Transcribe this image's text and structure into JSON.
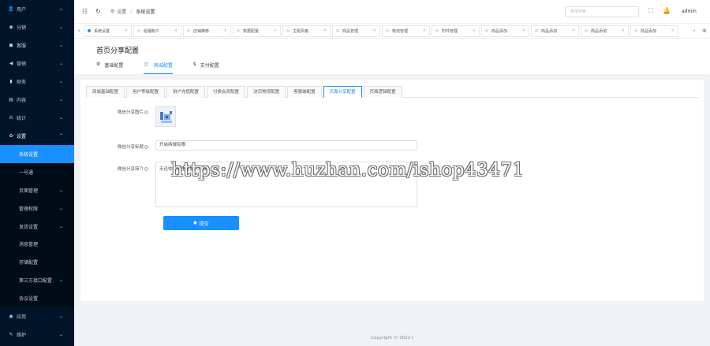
{
  "sidebar": {
    "items": [
      {
        "icon": "user-icon",
        "glyph": "👤",
        "label": "用户"
      },
      {
        "icon": "distribution-icon",
        "glyph": "◉",
        "label": "分销"
      },
      {
        "icon": "customer-service-icon",
        "glyph": "◼",
        "label": "客服"
      },
      {
        "icon": "marketing-icon",
        "glyph": "◀",
        "label": "营销"
      },
      {
        "icon": "finance-icon",
        "glyph": "▮",
        "label": "财务"
      },
      {
        "icon": "content-icon",
        "glyph": "▤",
        "label": "内容"
      },
      {
        "icon": "stats-icon",
        "glyph": "ılı",
        "label": "统计"
      },
      {
        "icon": "settings-icon",
        "glyph": "✿",
        "label": "设置"
      }
    ],
    "sub_items": [
      {
        "label": "系统设置",
        "active": true,
        "chev": false
      },
      {
        "label": "一号通",
        "active": false,
        "chev": false
      },
      {
        "label": "页面管理",
        "active": false,
        "chev": true
      },
      {
        "label": "管理权限",
        "active": false,
        "chev": true
      },
      {
        "label": "发货设置",
        "active": false,
        "chev": true
      },
      {
        "label": "消息管理",
        "active": false,
        "chev": false
      },
      {
        "label": "存储配置",
        "active": false,
        "chev": false
      },
      {
        "label": "第三方接口配置",
        "active": false,
        "chev": true
      },
      {
        "label": "协议设置",
        "active": false,
        "chev": false
      }
    ],
    "bottom_items": [
      {
        "icon": "app-icon",
        "glyph": "◉",
        "label": "应用"
      },
      {
        "icon": "maintenance-icon",
        "glyph": "✎",
        "label": "维护"
      }
    ]
  },
  "header": {
    "breadcrumb_root": "设置",
    "breadcrumb_current": "系统设置",
    "search_placeholder": "菜单搜索",
    "user": "admin"
  },
  "tabs": [
    {
      "label": "系统设置",
      "active": true
    },
    {
      "label": "组播账户",
      "active": false
    },
    {
      "label": "店铺推荐",
      "active": false
    },
    {
      "label": "数据配置",
      "active": false
    },
    {
      "label": "主题风格",
      "active": false
    },
    {
      "label": "商品管理",
      "active": false
    },
    {
      "label": "物流管理",
      "active": false
    },
    {
      "label": "附件管理",
      "active": false
    },
    {
      "label": "商品添加",
      "active": false
    },
    {
      "label": "商品添加",
      "active": false
    },
    {
      "label": "商品添加",
      "active": false
    },
    {
      "label": "商品添加",
      "active": false
    }
  ],
  "page": {
    "title": "首页分享配置",
    "tabs": [
      {
        "label": "基础配置",
        "icon": "gear-icon",
        "glyph": "⚙",
        "active": false
      },
      {
        "label": "商城配置",
        "icon": "cart-icon",
        "glyph": "🛒",
        "active": true
      },
      {
        "label": "支付配置",
        "icon": "dollar-icon",
        "glyph": "$",
        "active": false
      }
    ]
  },
  "subtabs": [
    {
      "label": "商城基础配置",
      "active": false
    },
    {
      "label": "用户等级配置",
      "active": false
    },
    {
      "label": "用户充值配置",
      "active": false
    },
    {
      "label": "付费会员配置",
      "active": false
    },
    {
      "label": "決宗物流配置",
      "active": false
    },
    {
      "label": "客服端配置",
      "active": false
    },
    {
      "label": "页面分享配置",
      "active": true
    },
    {
      "label": "页面逻辑配置",
      "active": false
    }
  ],
  "form": {
    "image_label": "微信分享图片",
    "title_label": "微信分享标题",
    "title_value": "开启商城有限",
    "desc_label": "微信分享简介",
    "desc_value": "无论你在哪里这家人线阁!",
    "submit_label": "提交"
  },
  "footer": "Copyright © 2022 |",
  "watermark": "https://www.huzhan.com/ishop43471"
}
